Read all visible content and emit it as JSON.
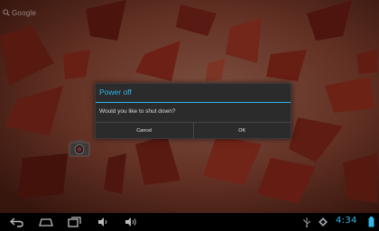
{
  "launcher": {
    "search_widget_label": "Google",
    "camera_shortcut_icon": "camera-icon"
  },
  "dialog": {
    "title": "Power off",
    "message": "Would you like to shut down?",
    "cancel_label": "Cancel",
    "ok_label": "OK",
    "accent_color": "#33b5e5"
  },
  "navbar": {
    "buttons": [
      "back-icon",
      "home-icon",
      "recent-apps-icon",
      "volume-down-icon",
      "volume-up-icon"
    ],
    "status_icons": [
      "usb-icon",
      "notification-icon",
      "battery-icon"
    ],
    "clock": "4:34",
    "accent_color": "#33b5e5"
  }
}
